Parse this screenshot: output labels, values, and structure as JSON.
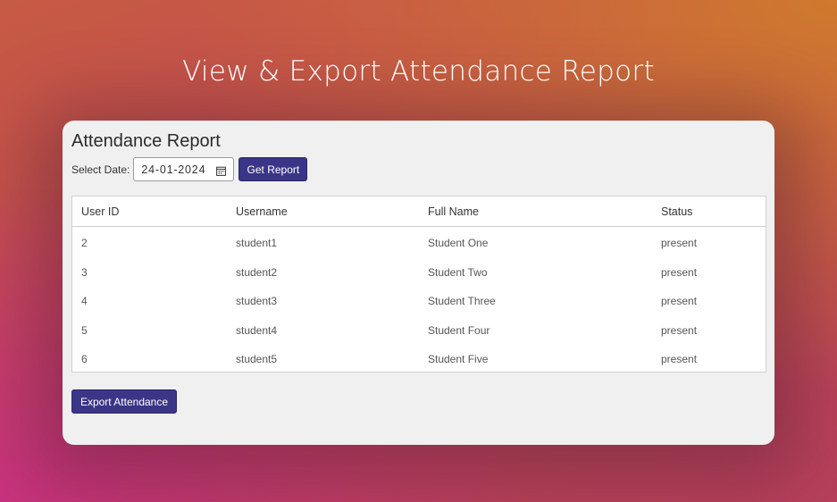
{
  "page": {
    "title": "View & Export Attendance Report"
  },
  "card": {
    "title": "Attendance Report",
    "date_label": "Select Date:",
    "date_value": "24-01-2024",
    "get_report_label": "Get Report",
    "export_label": "Export Attendance"
  },
  "table": {
    "headers": [
      "User ID",
      "Username",
      "Full Name",
      "Status"
    ],
    "rows": [
      [
        "2",
        "student1",
        "Student One",
        "present"
      ],
      [
        "3",
        "student2",
        "Student Two",
        "present"
      ],
      [
        "4",
        "student3",
        "Student Three",
        "present"
      ],
      [
        "5",
        "student4",
        "Student Four",
        "present"
      ],
      [
        "6",
        "student5",
        "Student Five",
        "present"
      ]
    ]
  },
  "colors": {
    "button": "#3b3587",
    "card_bg": "#f0f0f0"
  },
  "icons": {
    "date_picker": "calendar-icon"
  }
}
